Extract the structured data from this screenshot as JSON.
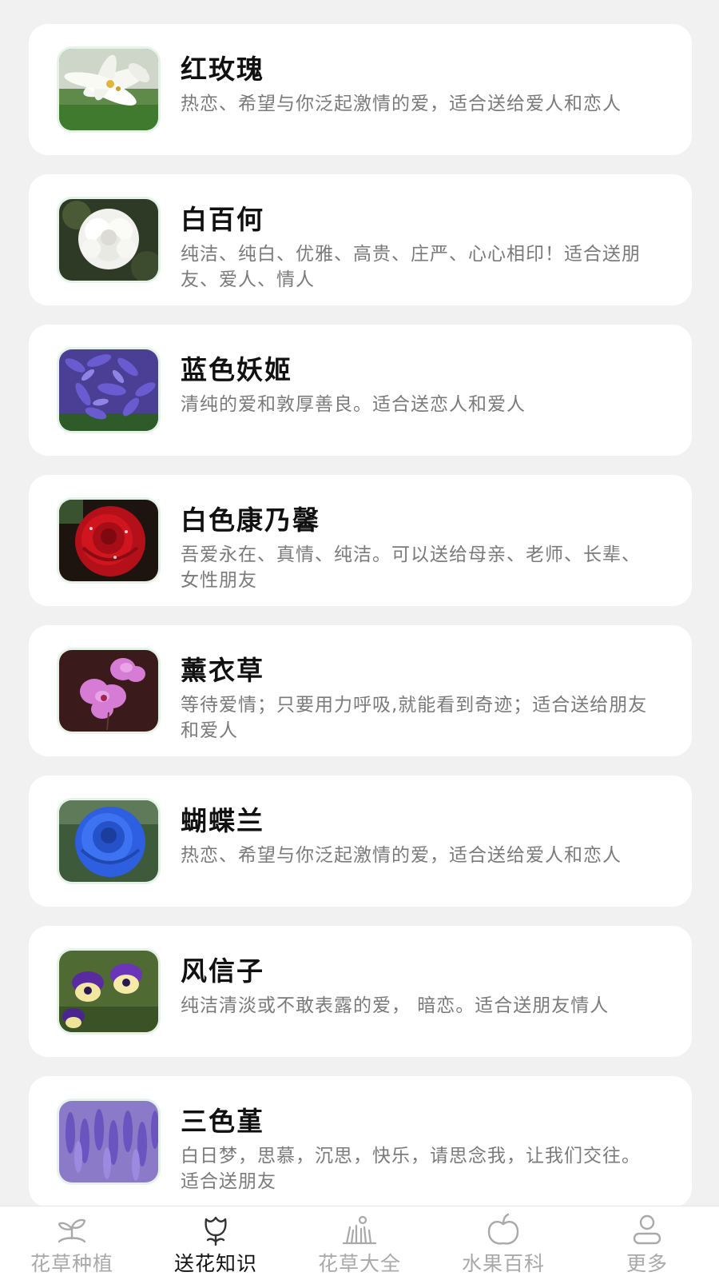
{
  "flowers": [
    {
      "name": "红玫瑰",
      "desc": "热恋、希望与你泛起激情的爱，适合送给爱人和恋人",
      "thumb_icon": "white-lily-photo"
    },
    {
      "name": "白百何",
      "desc": "纯洁、纯白、优雅、高贵、庄严、心心相印！适合送朋友、爱人、情人",
      "thumb_icon": "white-carnation-photo"
    },
    {
      "name": "蓝色妖姬",
      "desc": "清纯的爱和敦厚善良。适合送恋人和爱人",
      "thumb_icon": "purple-hyacinth-photo"
    },
    {
      "name": "白色康乃馨",
      "desc": "吾爱永在、真情、纯洁。可以送给母亲、老师、长辈、女性朋友",
      "thumb_icon": "red-rose-photo"
    },
    {
      "name": "薰衣草",
      "desc": "等待爱情；只要用力呼吸,就能看到奇迹；适合送给朋友和爱人",
      "thumb_icon": "pink-orchid-photo"
    },
    {
      "name": "蝴蝶兰",
      "desc": "热恋、希望与你泛起激情的爱，适合送给爱人和恋人",
      "thumb_icon": "blue-rose-photo"
    },
    {
      "name": "风信子",
      "desc": "纯洁清淡或不敢表露的爱， 暗恋。适合送朋友情人",
      "thumb_icon": "pansy-photo"
    },
    {
      "name": "三色堇",
      "desc": "白日梦，思慕，沉思，快乐，请思念我，让我们交往。适合送朋友",
      "thumb_icon": "lavender-photo"
    }
  ],
  "tabs": [
    {
      "label": "花草种植",
      "icon": "sprout-icon"
    },
    {
      "label": "送花知识",
      "icon": "tulip-icon"
    },
    {
      "label": "花草大全",
      "icon": "grass-icon"
    },
    {
      "label": "水果百科",
      "icon": "apple-icon"
    },
    {
      "label": "更多",
      "icon": "person-icon"
    }
  ],
  "active_tab": "送花知识",
  "colors": {
    "background": "#f1f1f1",
    "card": "#ffffff",
    "title": "#111111",
    "description": "#7a7a7a",
    "tab_inactive": "#a9a9a9",
    "tab_active": "#111111"
  }
}
